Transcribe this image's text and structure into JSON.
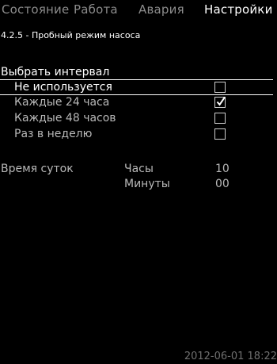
{
  "tabs": [
    {
      "label": "Состояние",
      "active": false
    },
    {
      "label": "Работа",
      "active": false
    },
    {
      "label": "Авария",
      "active": false
    },
    {
      "label": "Настройки",
      "active": true
    }
  ],
  "subtitle": "4.2.5 - Пробный режим насоса",
  "section_title": "Выбрать интервал",
  "options": [
    {
      "label": "Не используется",
      "checked": false,
      "selected": true
    },
    {
      "label": "Каждые 24 часа",
      "checked": true,
      "selected": false
    },
    {
      "label": "Каждые 48 часов",
      "checked": false,
      "selected": false
    },
    {
      "label": "Раз в неделю",
      "checked": false,
      "selected": false
    }
  ],
  "time": {
    "label": "Время суток",
    "hours_label": "Часы",
    "hours_value": "10",
    "minutes_label": "Минуты",
    "minutes_value": "00"
  },
  "footer_datetime": "2012-06-01 18:22"
}
